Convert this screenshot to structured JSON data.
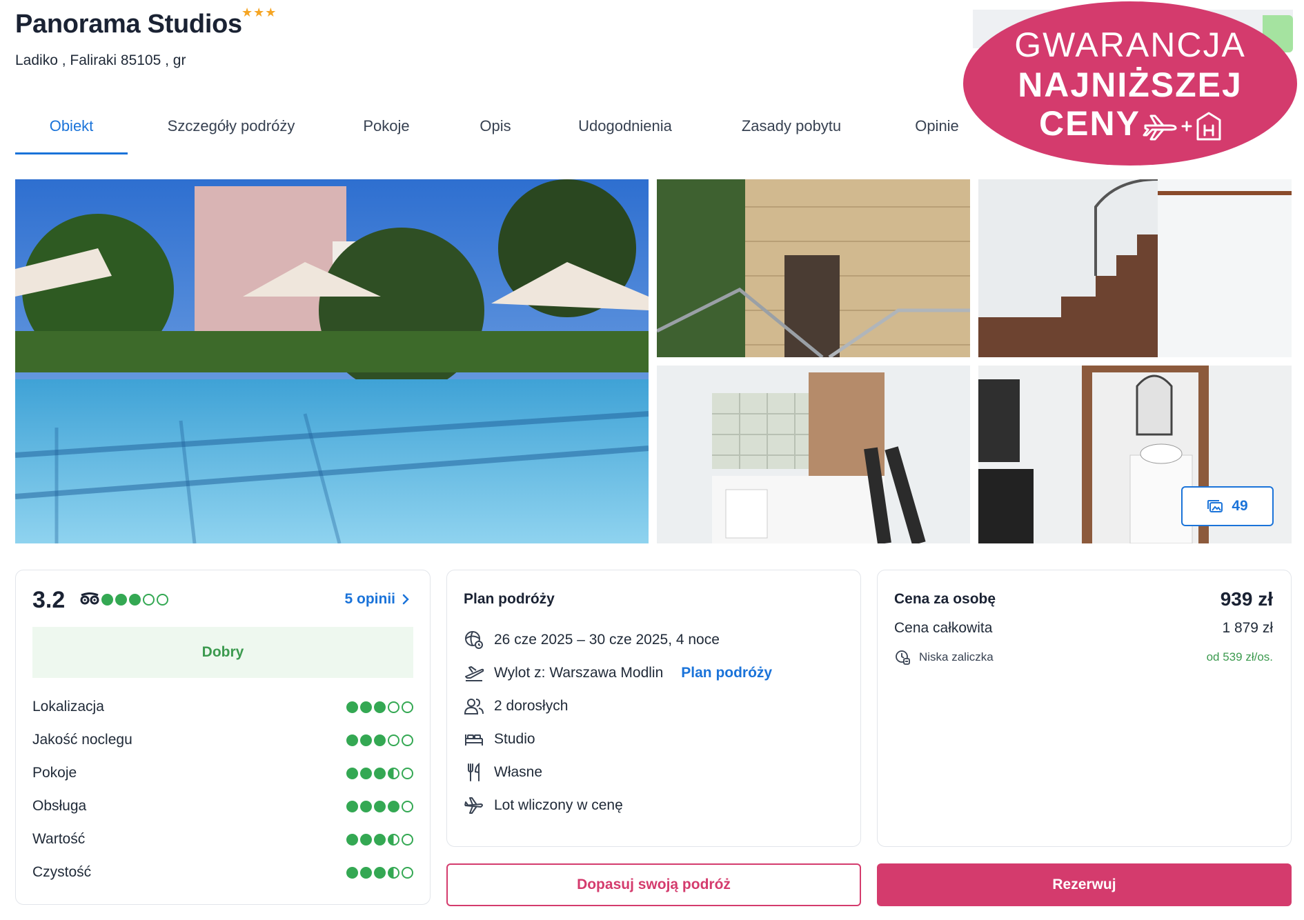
{
  "hotel": {
    "name": "Panorama Studios",
    "stars": "★★★",
    "address": "Ladiko , Faliraki 85105 , gr"
  },
  "tabs": [
    {
      "label": "Obiekt",
      "active": true
    },
    {
      "label": "Szczegóły podróży"
    },
    {
      "label": "Pokoje"
    },
    {
      "label": "Opis"
    },
    {
      "label": "Udogodnienia"
    },
    {
      "label": "Zasady pobytu"
    },
    {
      "label": "Opinie"
    }
  ],
  "badge": {
    "line1": "GWARANCJA",
    "line2": "NAJNIŻSZEJ",
    "line3": "CENY",
    "color": "#d43b6d"
  },
  "gallery": {
    "photo_count": "49",
    "photos": [
      "pool",
      "building-exterior",
      "spiral-staircase",
      "kitchenette",
      "bathroom"
    ]
  },
  "rating": {
    "score": "3.2",
    "overall_dots": 3,
    "reviews_link": "5 opinii",
    "label": "Dobry",
    "categories": [
      {
        "name": "Lokalizacja",
        "dots": 3
      },
      {
        "name": "Jakość noclegu",
        "dots": 3
      },
      {
        "name": "Pokoje",
        "dots": 3.5
      },
      {
        "name": "Obsługa",
        "dots": 4
      },
      {
        "name": "Wartość",
        "dots": 3.5
      },
      {
        "name": "Czystość",
        "dots": 3.5
      }
    ],
    "accent": "#34a853"
  },
  "plan": {
    "title": "Plan podróży",
    "dates": "26 cze 2025 – 30 cze 2025, 4 noce",
    "departure": "Wylot z: Warszawa Modlin",
    "departure_link": "Plan podróży",
    "guests": "2 dorosłych",
    "room": "Studio",
    "board": "Własne",
    "flight": "Lot wliczony w cenę"
  },
  "price": {
    "per_person_label": "Cena za osobę",
    "per_person": "939 zł",
    "total_label": "Cena całkowita",
    "total": "1 879 zł",
    "deposit_label": "Niska zaliczka",
    "deposit": "od 539 zł/os."
  },
  "buttons": {
    "customize": "Dopasuj swoją podróż",
    "book": "Rezerwuj"
  }
}
